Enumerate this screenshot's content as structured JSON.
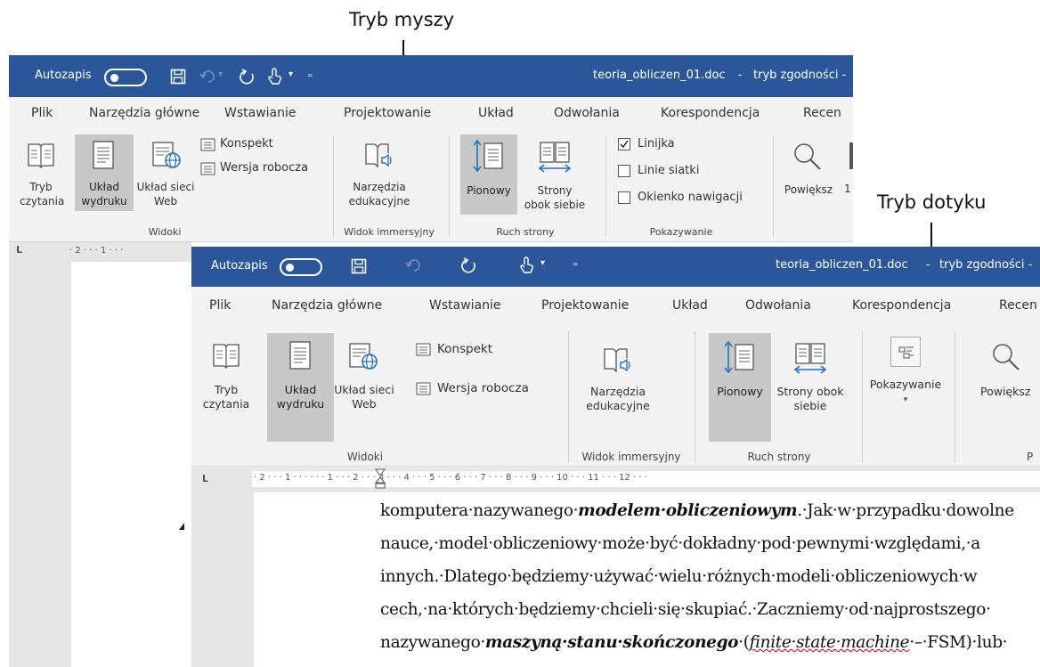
{
  "callouts": {
    "mouse_mode": "Tryb myszy",
    "touch_mode": "Tryb dotyku"
  },
  "colors": {
    "titlebar": "#2b579a",
    "ribbon_bg": "#f3f3f3",
    "selected_button": "#c8c8c8",
    "icon_blue": "#1e72c8",
    "spell_error": "#c00000"
  },
  "mouse_window": {
    "autosave_label": "Autozapis",
    "filename": "teoria_obliczen_01.doc",
    "title_separator": "-",
    "compat_mode": "tryb zgodności -",
    "tabs": [
      "Plik",
      "Narzędzia główne",
      "Wstawianie",
      "Projektowanie",
      "Układ",
      "Odwołania",
      "Korespondencja",
      "Recen"
    ],
    "ribbon": {
      "tryb_czytania": "Tryb czytania",
      "uklad_wydruku": "Układ wydruku",
      "uklad_sieci_web": "Układ sieci Web",
      "konspekt": "Konspekt",
      "wersja_robocza": "Wersja robocza",
      "narzedzia_edukacyjne": "Narzędzia edukacyjne",
      "pionowy": "Pionowy",
      "strony_obok_siebie": "Strony obok siebie",
      "linijka": "Linijka",
      "linie_siatki": "Linie siatki",
      "okienko_nawigacji": "Okienko nawigacji",
      "powieksz": "Powiększ",
      "powieksz_cut": "1"
    },
    "checks": {
      "linijka": true,
      "linie_siatki": false,
      "okienko_nawigacji": false
    },
    "groups": {
      "widoki": "Widoki",
      "widok_immersyjny": "Widok immersyjny",
      "ruch_strony": "Ruch strony",
      "pokazywanie": "Pokazywanie"
    },
    "ruler_corner": "L",
    "ruler_text": "· 2 · · · 1 · · ·"
  },
  "touch_window": {
    "autosave_label": "Autozapis",
    "filename": "teoria_obliczen_01.doc",
    "title_separator": "-",
    "compat_mode": "tryb zgodności -",
    "tabs": [
      "Plik",
      "Narzędzia główne",
      "Wstawianie",
      "Projektowanie",
      "Układ",
      "Odwołania",
      "Korespondencja",
      "Recen"
    ],
    "ribbon": {
      "tryb_czytania": "Tryb czytania",
      "uklad_wydruku": "Układ wydruku",
      "uklad_sieci_web": "Układ sieci Web",
      "konspekt": "Konspekt",
      "wersja_robocza": "Wersja robocza",
      "narzedzia_edukacyjne": "Narzędzia edukacyjne",
      "pionowy": "Pionowy",
      "strony_obok_siebie": "Strony obok siebie",
      "pokazywanie": "Pokazywanie",
      "powieksz": "Powiększ"
    },
    "groups": {
      "widoki": "Widoki",
      "widok_immersyjny": "Widok immersyjny",
      "ruch_strony": "Ruch strony",
      "cut": "P"
    },
    "ruler_corner": "L",
    "ruler_text": "· 2 · · · 1 · · ·   · · · 1 · · · 2 · · · 3 · · · 4 · · · 5 · · · 6 · · · 7 · · · 8 · · · 9 · · · 10 · · · 11 · · · 12 · · ·",
    "document": {
      "line1_a": "komputera·nazywanego·",
      "line1_b": "modelem·obliczeniowym",
      "line1_c": ".·Jak·w·przypadku·dowolne",
      "line2": "nauce,·model·obliczeniowy·może·być·dokładny·pod·pewnymi·względami,·a",
      "line3": "innych.·Dlatego·będziemy·używać·wielu·różnych·modeli·obliczeniowych·w",
      "line4": "cech,·na·których·będziemy·chcieli·się·skupiać.·Zaczniemy·od·najprostszego·",
      "line5_a": "nazywanego·",
      "line5_b": "maszyną·stanu·skończonego",
      "line5_c": "·(",
      "line5_d": "finite·state·machine",
      "line5_e": "·–·FSM)·lub·"
    }
  }
}
